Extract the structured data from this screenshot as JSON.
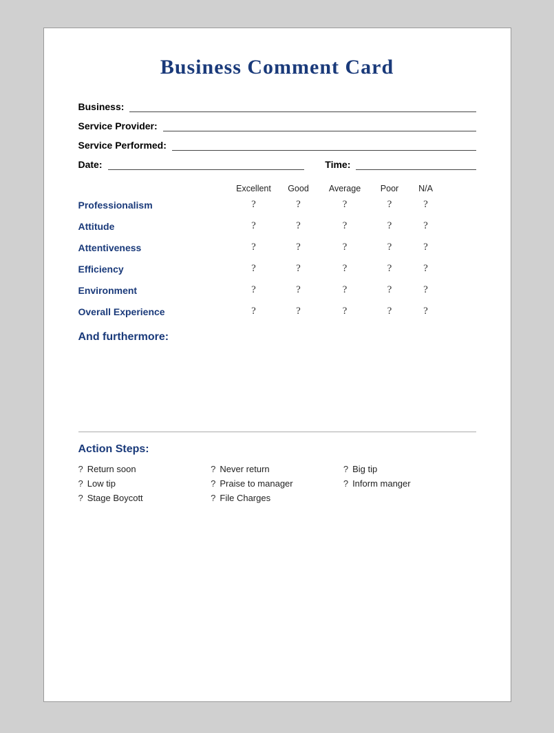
{
  "card": {
    "title": "Business Comment Card"
  },
  "fields": {
    "business_label": "Business:",
    "service_provider_label": "Service Provider:",
    "service_performed_label": "Service Performed:",
    "date_label": "Date:",
    "time_label": "Time:"
  },
  "ratings": {
    "headers": [
      "",
      "Excellent",
      "Good",
      "Average",
      "Poor",
      "N/A"
    ],
    "rows": [
      {
        "label": "Professionalism",
        "values": [
          "?",
          "?",
          "?",
          "?",
          "?"
        ]
      },
      {
        "label": "Attitude",
        "values": [
          "?",
          "?",
          "?",
          "?",
          "?"
        ]
      },
      {
        "label": "Attentiveness",
        "values": [
          "?",
          "?",
          "?",
          "?",
          "?"
        ]
      },
      {
        "label": "Efficiency",
        "values": [
          "?",
          "?",
          "?",
          "?",
          "?"
        ]
      },
      {
        "label": "Environment",
        "values": [
          "?",
          "?",
          "?",
          "?",
          "?"
        ]
      },
      {
        "label": "Overall Experience",
        "values": [
          "?",
          "?",
          "?",
          "?",
          "?"
        ]
      }
    ]
  },
  "furthermore": {
    "title": "And furthermore:"
  },
  "action_steps": {
    "title": "Action Steps:",
    "items": [
      {
        "icon": "?",
        "text": "Return soon"
      },
      {
        "icon": "?",
        "text": "Never return"
      },
      {
        "icon": "?",
        "text": "Big tip"
      },
      {
        "icon": "?",
        "text": "Low tip"
      },
      {
        "icon": "?",
        "text": "Praise to manager"
      },
      {
        "icon": "?",
        "text": "Inform manger"
      },
      {
        "icon": "?",
        "text": "Stage Boycott"
      },
      {
        "icon": "?",
        "text": "File Charges"
      },
      {
        "icon": "",
        "text": ""
      }
    ]
  }
}
